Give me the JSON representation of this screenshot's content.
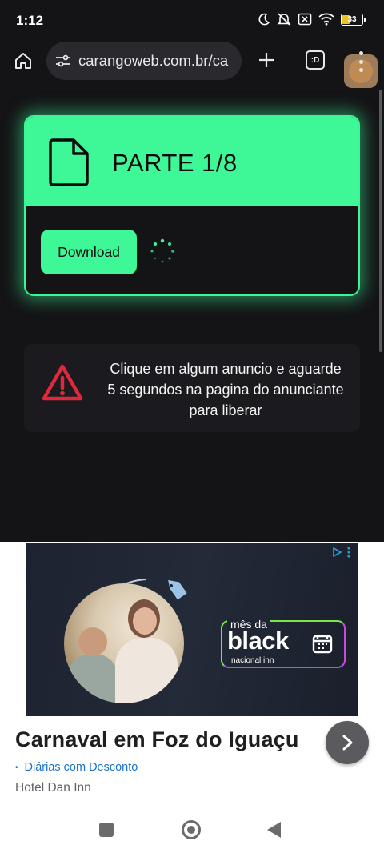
{
  "status_bar": {
    "time": "1:12",
    "battery": "33"
  },
  "browser": {
    "url": "carangoweb.com.br/ca",
    "tabs_label": ":D"
  },
  "part_card": {
    "title": "PARTE 1/8",
    "download_label": "Download",
    "accent_color": "#3ef898"
  },
  "notice": {
    "text": "Clique em algum anuncio e aguarde 5 segundos na pagina do anunciante para liberar",
    "icon_color": "#e0283c"
  },
  "ad": {
    "banner_top": "mês da",
    "banner_main": "black",
    "banner_bottom": "nacional inn",
    "title": "Carnaval em Foz do Iguaçu",
    "subtitle": "Diárias com Desconto",
    "subtitle_bullet": "•",
    "advertiser": "Hotel Dan Inn"
  }
}
